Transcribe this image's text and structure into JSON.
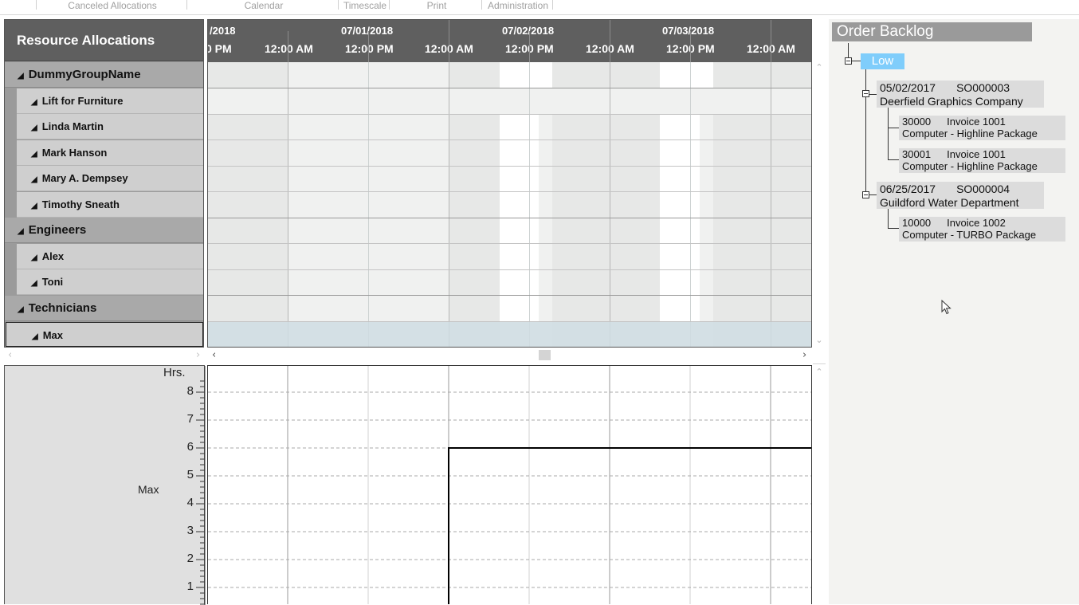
{
  "ribbon": {
    "tabs": [
      "Canceled Allocations",
      "Calendar",
      "Timescale",
      "Print",
      "Administration"
    ]
  },
  "resources": {
    "title": "Resource Allocations",
    "rows": [
      {
        "kind": "group",
        "label": "DummyGroupName"
      },
      {
        "kind": "item",
        "label": "Lift for Furniture"
      },
      {
        "kind": "item",
        "label": "Linda Martin"
      },
      {
        "kind": "item",
        "label": "Mark Hanson"
      },
      {
        "kind": "item",
        "label": "Mary A. Dempsey"
      },
      {
        "kind": "item",
        "label": "Timothy Sneath"
      },
      {
        "kind": "group",
        "label": "Engineers"
      },
      {
        "kind": "item",
        "label": "Alex"
      },
      {
        "kind": "item",
        "label": "Toni"
      },
      {
        "kind": "group",
        "label": "Technicians"
      },
      {
        "kind": "item",
        "label": "Max",
        "selected": true
      }
    ]
  },
  "timeline": {
    "dates": [
      "/2018",
      "07/01/2018",
      "07/02/2018",
      "07/03/2018"
    ],
    "times": [
      "0 PM",
      "12:00 AM",
      "12:00 PM",
      "12:00 AM",
      "12:00 PM",
      "12:00 AM",
      "12:00 PM",
      "12:00 AM"
    ]
  },
  "chart": {
    "axis_unit": "Hrs.",
    "resource_label": "Max",
    "y_ticks": [
      "8",
      "7",
      "6",
      "5",
      "4",
      "3",
      "2",
      "1"
    ]
  },
  "chart_data": {
    "type": "line",
    "ylabel": "Hrs.",
    "ylim": [
      0,
      8.7
    ],
    "series": [
      {
        "name": "Max",
        "points": [
          {
            "x": "07/01/2018 12:00 AM",
            "y": 0
          },
          {
            "x": "07/02/2018 12:00 AM",
            "y": 0
          },
          {
            "x": "07/02/2018 12:00 AM",
            "y": 6
          },
          {
            "x": "07/03/2018 11:59 PM",
            "y": 6
          }
        ]
      }
    ]
  },
  "backlog": {
    "title": "Order Backlog",
    "priority": "Low",
    "orders": [
      {
        "date": "05/02/2017",
        "number": "SO000003",
        "customer": "Deerfield Graphics Company",
        "lines": [
          {
            "qty": "30000",
            "invoice": "Invoice 1001",
            "desc": "Computer - Highline Package"
          },
          {
            "qty": "30001",
            "invoice": "Invoice 1001",
            "desc": "Computer - Highline Package"
          }
        ]
      },
      {
        "date": "06/25/2017",
        "number": "SO000004",
        "customer": "Guildford Water Department",
        "lines": [
          {
            "qty": "10000",
            "invoice": "Invoice 1002",
            "desc": "Computer - TURBO Package"
          }
        ]
      }
    ]
  }
}
